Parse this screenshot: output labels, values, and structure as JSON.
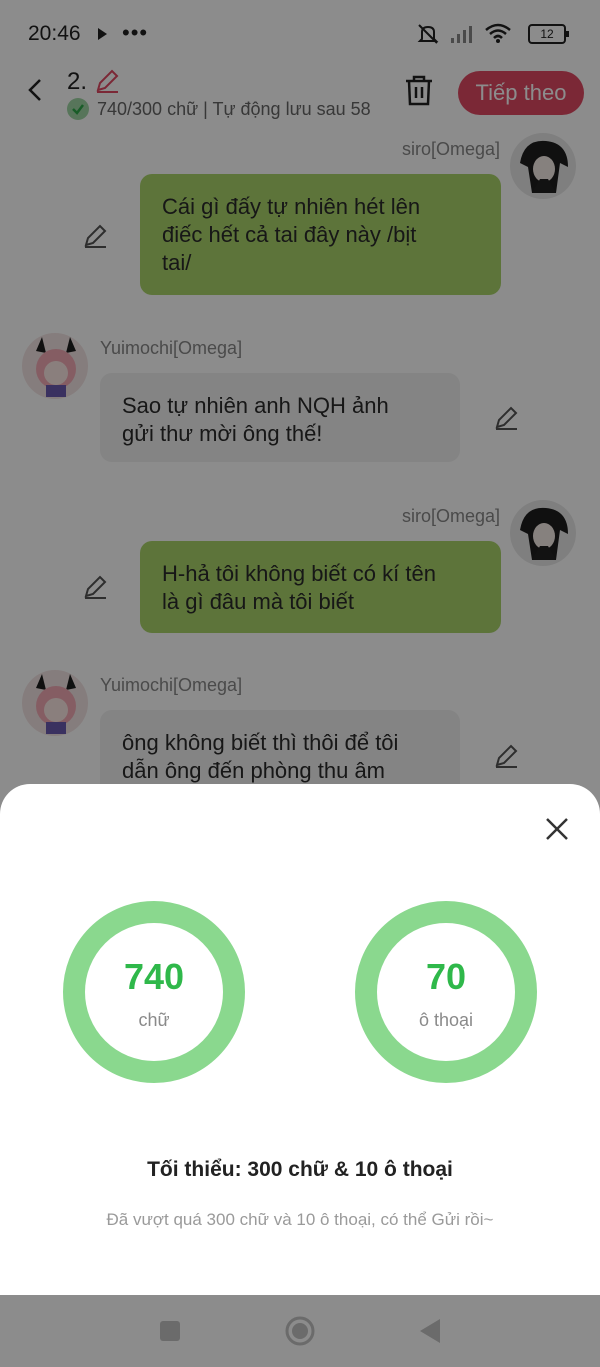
{
  "status_bar": {
    "time": "20:46",
    "battery": "12"
  },
  "header": {
    "chapter_number": "2.",
    "save_info": "740/300 chữ | Tự động lưu sau 58",
    "next_label": "Tiếp theo"
  },
  "messages": [
    {
      "side": "right",
      "name": "siro[Omega]",
      "text_lines": [
        "Cái gì đấy tự nhiên hét lên",
        "điếc hết cả tai đây này /bịt",
        "tai/"
      ]
    },
    {
      "side": "left",
      "name": "Yuimochi[Omega]",
      "text_lines": [
        "Sao tự nhiên anh NQH ảnh",
        "gửi thư mời ông thế!"
      ]
    },
    {
      "side": "right",
      "name": "siro[Omega]",
      "text_lines": [
        "H-hả tôi không biết có kí tên",
        "là gì đâu mà tôi biết"
      ]
    },
    {
      "side": "left",
      "name": "Yuimochi[Omega]",
      "text_lines": [
        "ông không biết thì thôi để tôi",
        "dẫn ông đến phòng thu âm"
      ]
    }
  ],
  "sheet": {
    "words_value": "740",
    "words_label": "chữ",
    "dialogs_value": "70",
    "dialogs_label": "ô thoại",
    "minimum_title": "Tối thiểu: 300 chữ & 10 ô thoại",
    "minimum_note": "Đã vượt quá 300 chữ và 10 ô thoại, có thể Gửi rồi~"
  },
  "colors": {
    "accent": "#e04a63",
    "ring": "#8ad88e",
    "ring_text": "#2fb84a",
    "mine_bubble": "#a9d46b"
  }
}
